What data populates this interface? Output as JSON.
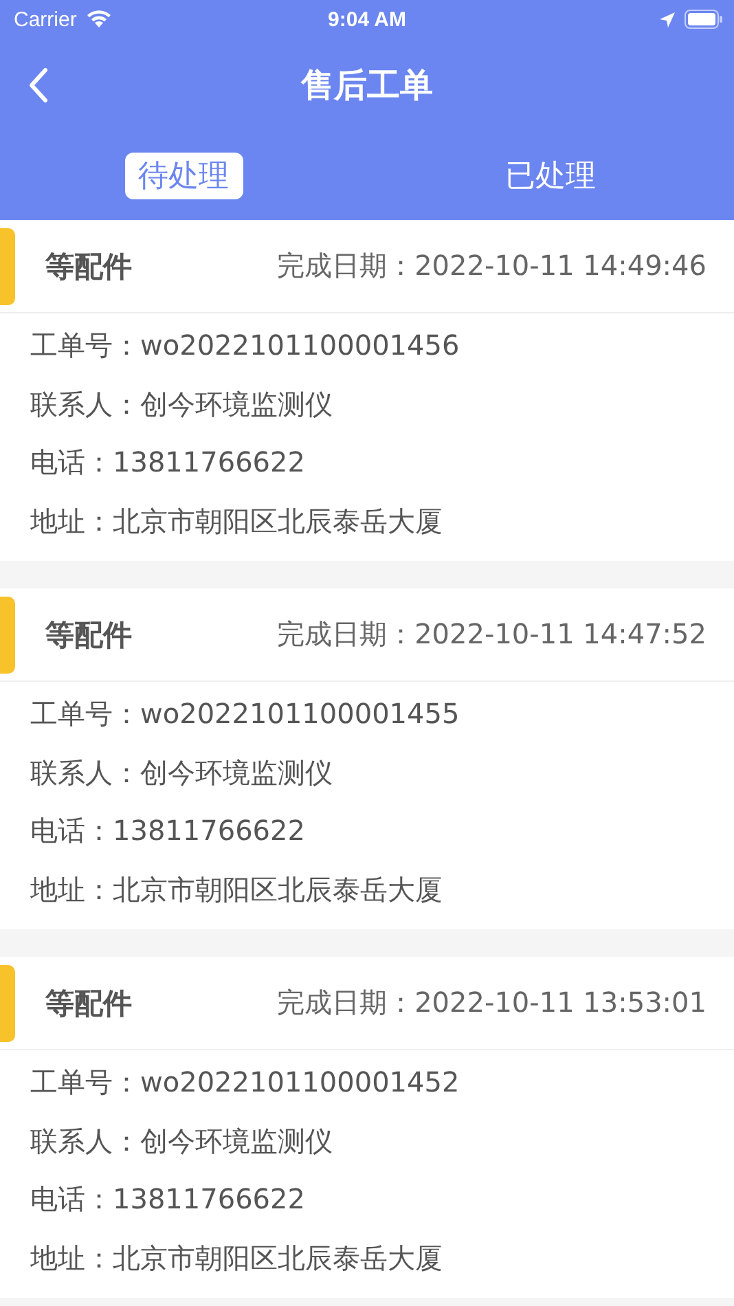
{
  "status_bar": {
    "carrier": "Carrier",
    "time": "9:04 AM"
  },
  "header": {
    "title": "售后工单"
  },
  "tabs": [
    {
      "label": "待处理",
      "selected": true
    },
    {
      "label": "已处理",
      "selected": false
    }
  ],
  "orders": [
    {
      "status": "等配件",
      "date": "完成日期：2022-10-11 14:49:46",
      "fields": [
        "工单号：wo2022101100001456",
        "联系人：创今环境监测仪",
        "电话：13811766622",
        "地址：北京市朝阳区北辰泰岳大厦"
      ]
    },
    {
      "status": "等配件",
      "date": "完成日期：2022-10-11 14:47:52",
      "fields": [
        "工单号：wo2022101100001455",
        "联系人：创今环境监测仪",
        "电话：13811766622",
        "地址：北京市朝阳区北辰泰岳大厦"
      ]
    },
    {
      "status": "等配件",
      "date": "完成日期：2022-10-11 13:53:01",
      "fields": [
        "工单号：wo2022101100001452",
        "联系人：创今环境监测仪",
        "电话：13811766622",
        "地址：北京市朝阳区北辰泰岳大厦"
      ]
    }
  ]
}
